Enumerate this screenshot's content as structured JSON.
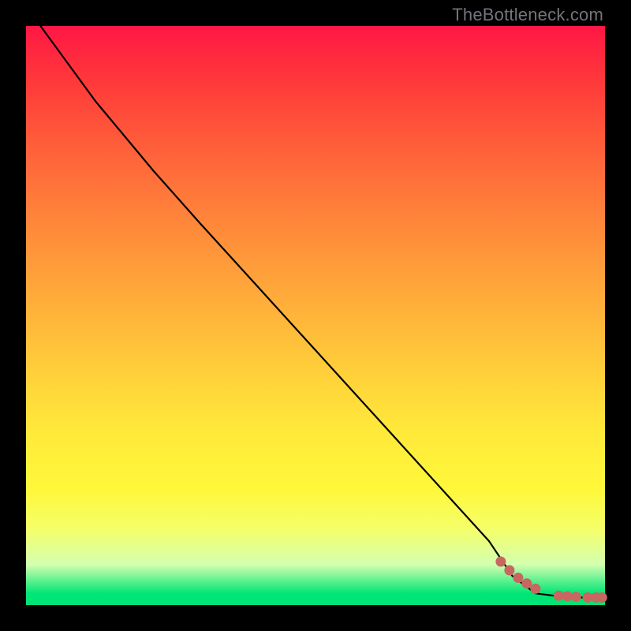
{
  "watermark": "TheBottleneck.com",
  "chart_data": {
    "type": "line",
    "title": "",
    "xlabel": "",
    "ylabel": "",
    "xlim": [
      0,
      100
    ],
    "ylim": [
      0,
      100
    ],
    "grid": false,
    "legend": false,
    "series": [
      {
        "name": "curve",
        "style": "line",
        "color": "#000000",
        "x": [
          2.5,
          12,
          22,
          30,
          40,
          50,
          60,
          70,
          80,
          84,
          88,
          92,
          96,
          99.5
        ],
        "values": [
          100,
          87,
          75,
          66,
          55,
          44,
          33,
          22,
          11,
          5,
          2,
          1.5,
          1.3,
          1.3
        ]
      },
      {
        "name": "dots",
        "style": "scatter",
        "color": "#c96660",
        "x": [
          82,
          83.5,
          85,
          86.5,
          88,
          92,
          93.5,
          95,
          97,
          98.5,
          99.5
        ],
        "values": [
          7.5,
          6.0,
          4.7,
          3.7,
          2.8,
          1.6,
          1.5,
          1.4,
          1.3,
          1.3,
          1.3
        ]
      }
    ]
  }
}
